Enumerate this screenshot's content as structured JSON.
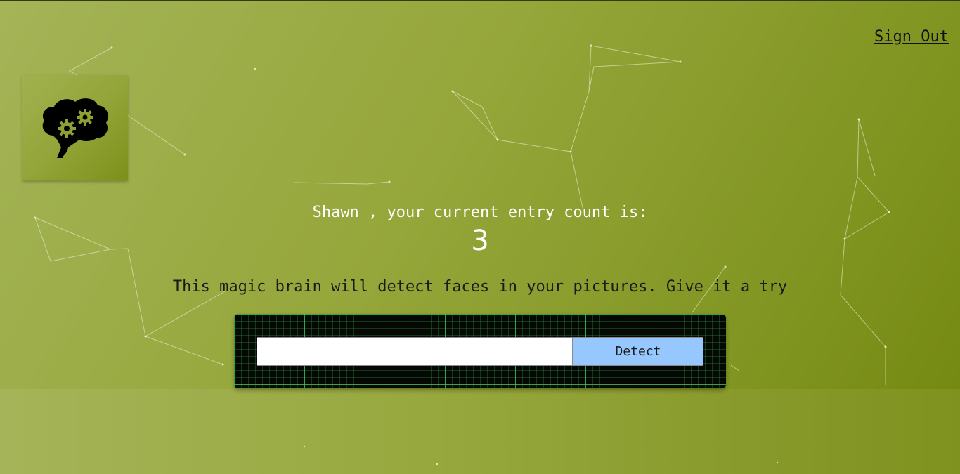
{
  "app": {
    "sign_out_label": "Sign Out"
  },
  "logo": {
    "icon": "brain-gears-icon"
  },
  "profile": {
    "greeting": "Shawn , your current entry count is:",
    "entry_count": "3"
  },
  "main": {
    "tagline": "This magic brain will detect faces in your pictures. Give it a try"
  },
  "form": {
    "url_input_value": "",
    "url_input_placeholder": "",
    "detect_button_label": "Detect"
  },
  "colors": {
    "background_accent": "#8fa033",
    "detect_button": "#96c8ff",
    "panel_grid": "#3cc85a"
  }
}
